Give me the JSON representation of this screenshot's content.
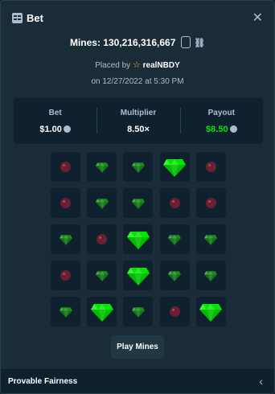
{
  "header": {
    "title": "Bet",
    "close_glyph": "✕"
  },
  "game": {
    "label": "Mines: 130,216,316,667"
  },
  "placed": {
    "prefix": "Placed by",
    "user": "realNBDY",
    "date": "on 12/27/2022 at 5:30 PM"
  },
  "stats": [
    {
      "label": "Bet",
      "value": "$1.00",
      "icon": "coin-icon"
    },
    {
      "label": "Multiplier",
      "value": "8.50×"
    },
    {
      "label": "Payout",
      "value": "$8.50",
      "icon": "coin-icon"
    }
  ],
  "colors": {
    "payout": "#00e701",
    "gem_revealed": "#00e701",
    "gem_hidden": "#1a8c1a",
    "mine": "#6a1f33"
  },
  "board": [
    [
      "mine",
      "gem",
      "gem",
      "gem_revealed",
      "mine"
    ],
    [
      "mine",
      "gem",
      "gem",
      "mine",
      "mine"
    ],
    [
      "gem",
      "mine",
      "gem_revealed",
      "gem",
      "gem"
    ],
    [
      "mine",
      "gem",
      "gem_revealed",
      "gem",
      "gem"
    ],
    [
      "gem",
      "gem_revealed",
      "gem",
      "mine",
      "gem_revealed"
    ]
  ],
  "play_button": "Play Mines",
  "footer": {
    "label": "Provable Fairness",
    "chevron": "‹"
  }
}
